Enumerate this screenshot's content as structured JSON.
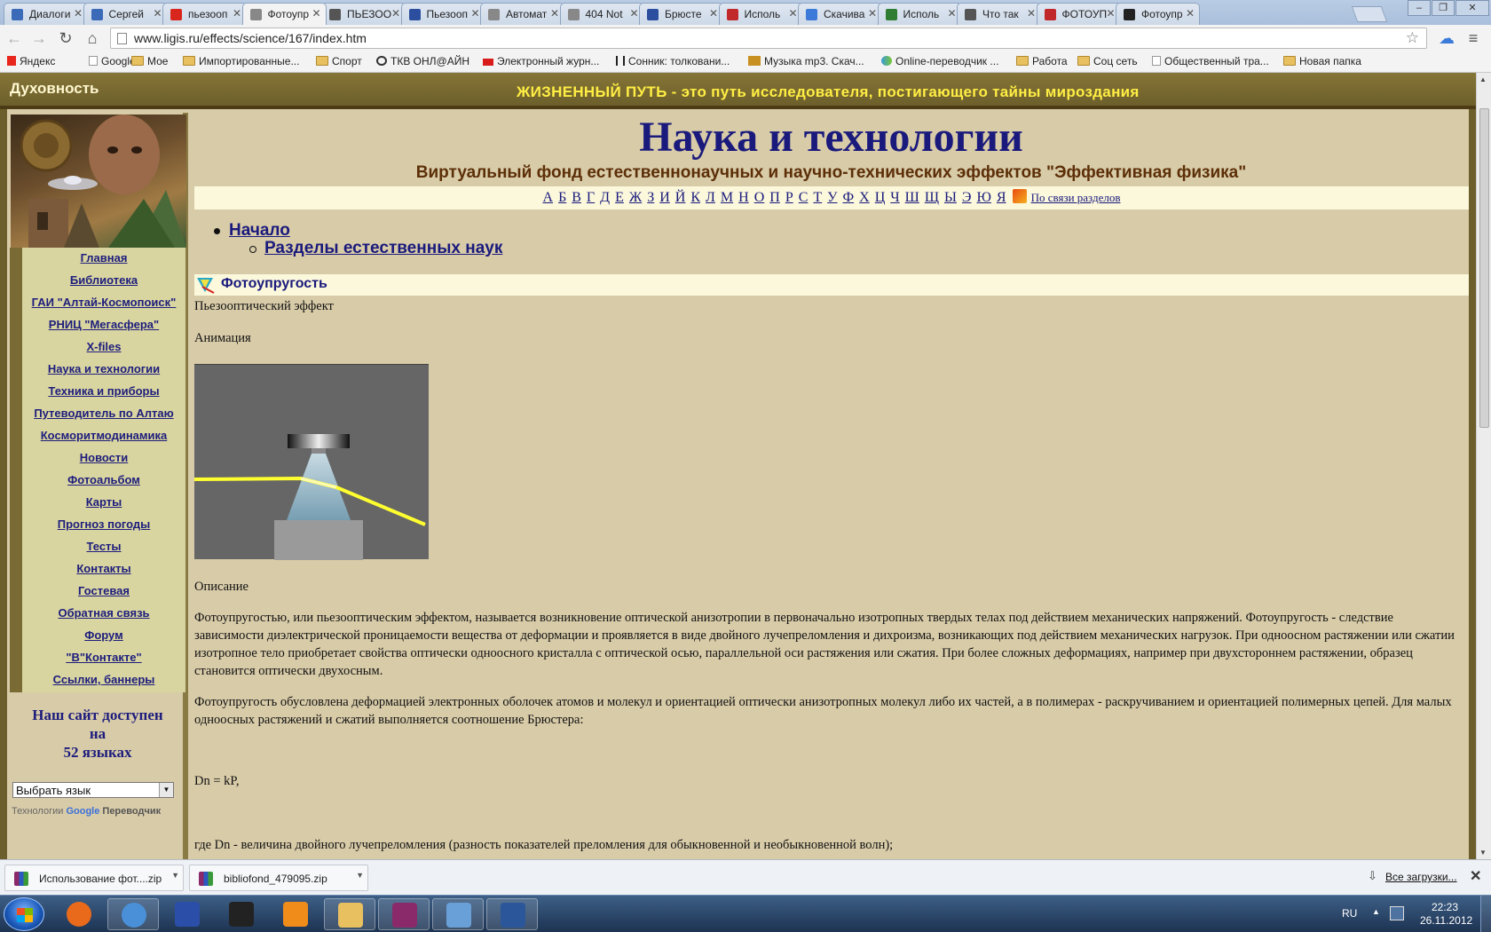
{
  "browser": {
    "tabs": [
      {
        "label": "Диалоги",
        "icon_color": "#3b6ab8"
      },
      {
        "label": "Сергей",
        "icon_color": "#3b6ab8"
      },
      {
        "label": "пьезооп",
        "icon_color": "#d8261c"
      },
      {
        "label": "Фотоупр",
        "icon_color": "#888888"
      },
      {
        "label": "ПЬЕЗОО",
        "icon_color": "#555555"
      },
      {
        "label": "Пьезооп",
        "icon_color": "#2b4f9e"
      },
      {
        "label": "Автомат",
        "icon_color": "#888888"
      },
      {
        "label": "404 Not",
        "icon_color": "#888888"
      },
      {
        "label": "Брюсте",
        "icon_color": "#2b4f9e"
      },
      {
        "label": "Исполь",
        "icon_color": "#c0282a"
      },
      {
        "label": "Скачива",
        "icon_color": "#3b7ad8"
      },
      {
        "label": "Исполь",
        "icon_color": "#2e7d32"
      },
      {
        "label": "Что так",
        "icon_color": "#555555"
      },
      {
        "label": "ФОТОУП",
        "icon_color": "#c0282a"
      },
      {
        "label": "Фотоупр",
        "icon_color": "#222222"
      }
    ],
    "active_tab": 3,
    "url": "www.ligis.ru/effects/science/167/index.htm",
    "bookmarks": [
      {
        "label": "Яндекс",
        "icon": "yandex-icon"
      },
      {
        "label": "Google",
        "icon": "page-icon"
      },
      {
        "label": "Мое",
        "icon": "folder-icon"
      },
      {
        "label": "Импортированные...",
        "icon": "folder-icon"
      },
      {
        "label": "Спорт",
        "icon": "folder-icon"
      },
      {
        "label": "ТКВ ОНЛ@АЙН",
        "icon": "tv-icon"
      },
      {
        "label": "Электронный журн...",
        "icon": "journal-icon"
      },
      {
        "label": "Сонник: толковани...",
        "icon": "virgo-icon"
      },
      {
        "label": "Музыка mp3. Скач...",
        "icon": "music-icon"
      },
      {
        "label": "Online-переводчик ...",
        "icon": "translator-icon"
      },
      {
        "label": "Работа",
        "icon": "folder-icon"
      },
      {
        "label": "Соц сеть",
        "icon": "folder-icon"
      },
      {
        "label": "Общественный тра...",
        "icon": "page-icon"
      },
      {
        "label": "Новая папка",
        "icon": "folder-icon"
      }
    ]
  },
  "site": {
    "name": "Духовность",
    "motto": "ЖИЗНЕННЫЙ ПУТЬ - это путь исследователя, постигающего тайны мироздания",
    "menu": [
      "Главная",
      "Библиотека",
      "ГАИ \"Алтай-Космопоиск\"",
      "РНИЦ \"Мегасфера\"",
      "X-files",
      "Наука и технологии",
      "Техника и приборы",
      "Путеводитель по Алтаю",
      "Косморитмодинамика",
      "Новости",
      "Фотоальбом",
      "Карты",
      "Прогноз погоды",
      "Тесты",
      "Контакты",
      "Гостевая",
      "Обратная связь",
      "Форум",
      "\"В\"Контакте\"",
      "Ссылки, баннеры"
    ],
    "lang_notice": [
      "Наш сайт доступен",
      "на",
      "52 языках"
    ],
    "lang_select": "Выбрать язык",
    "gtrans_prefix": "Технологии",
    "gtrans_brand": "Google",
    "gtrans_suffix": "Переводчик"
  },
  "content": {
    "title": "Наука и технологии",
    "subtitle": "Виртуальный фонд естественнонаучных и научно-технических эффектов \"Эффективная физика\"",
    "alphabet": [
      "А",
      "Б",
      "В",
      "Г",
      "Д",
      "Е",
      "Ж",
      "З",
      "И",
      "Й",
      "К",
      "Л",
      "М",
      "Н",
      "О",
      "П",
      "Р",
      "С",
      "Т",
      "У",
      "Ф",
      "Х",
      "Ц",
      "Ч",
      "Ш",
      "Щ",
      "Ы",
      "Э",
      "Ю",
      "Я"
    ],
    "section_links": "По связи разделов",
    "breadcrumb_1": "Начало",
    "breadcrumb_2": "Разделы естественных наук",
    "effect_title": "Фотоупругость",
    "alt_name": "Пьезооптический эффект",
    "animation_label": "Анимация",
    "description_label": "Описание",
    "para1": "Фотоупругостью, или пьезооптическим эффектом, называется возникновение оптической анизотропии в первоначально изотропных твердых телах под действием механических напряжений. Фотоупругость - следствие зависимости диэлектрической проницаемости вещества от деформации и проявляется в виде двойного лучепреломления и дихроизма, возникающих под действием механических нагрузок. При одноосном растяжении или сжатии изотропное тело приобретает свойства оптически одноосного кристалла с оптической осью, параллельной оси растяжения или сжатия. При более сложных деформациях, например при двухстороннем растяжении, образец становится оптически двухосным.",
    "para2": "Фотоупругость обусловлена деформацией электронных оболочек атомов и молекул и ориентацией оптически анизотропных молекул либо их частей, а в полимерах - раскручиванием и ориентацией полимерных цепей. Для малых одноосных растяжений и сжатий выполняется соотношение Брюстера:",
    "formula": "Dn = kP,",
    "para3": "где Dn - величина двойного лучепреломления (разность показателей преломления для обыкновенной и необыкновенной волн);"
  },
  "downloads": {
    "items": [
      "Использование фот....zip",
      "bibliofond_479095.zip"
    ],
    "all_label": "Все загрузки..."
  },
  "taskbar": {
    "lang": "RU",
    "time": "22:23",
    "date": "26.11.2012",
    "apps": [
      {
        "name": "firefox",
        "color": "#e86a1a",
        "open": false
      },
      {
        "name": "chrome",
        "color": "#4a90d8",
        "open": true
      },
      {
        "name": "floppy",
        "color": "#2b4fa8",
        "open": false
      },
      {
        "name": "plugin",
        "color": "#222222",
        "open": false
      },
      {
        "name": "media",
        "color": "#f08c1a",
        "open": false
      },
      {
        "name": "explorer",
        "color": "#e8c060",
        "open": true
      },
      {
        "name": "winrar",
        "color": "#8a2a6a",
        "open": true
      },
      {
        "name": "picture",
        "color": "#6aa0d8",
        "open": true
      },
      {
        "name": "word",
        "color": "#2b579a",
        "open": true
      }
    ]
  },
  "colors": {
    "site_bar": "#857537",
    "page_bg": "#d8cba8",
    "link": "#1a1a7c",
    "subtitle": "#5c2f08",
    "motto": "#ffee44",
    "menu_bg": "#d9d5a0"
  }
}
